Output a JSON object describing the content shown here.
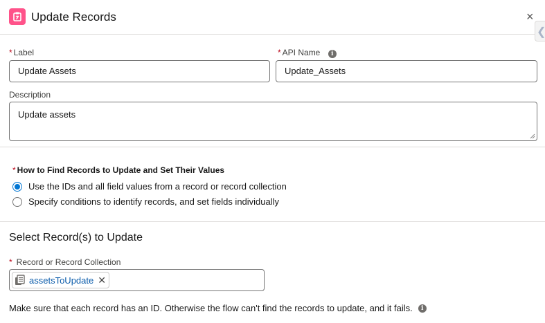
{
  "header": {
    "title": "Update Records",
    "accent_color": "#ff538a",
    "icon": "update-records-icon",
    "close_glyph": "×",
    "edge_tab_glyph": "❮"
  },
  "form": {
    "required_marker": "*",
    "label": {
      "label": "Label",
      "value": "Update Assets"
    },
    "api_name": {
      "label": "API Name",
      "value": "Update_Assets"
    },
    "description": {
      "label": "Description",
      "value": "Update assets"
    }
  },
  "find_records": {
    "heading": "How to Find Records to Update and Set Their Values",
    "options": [
      {
        "label": "Use the IDs and all field values from a record or record collection",
        "selected": true
      },
      {
        "label": "Specify conditions to identify records, and set fields individually",
        "selected": false
      }
    ]
  },
  "select_section": {
    "title": "Select Record(s) to Update",
    "field_label": "Record or Record Collection",
    "pill_value": "assetsToUpdate",
    "pill_remove_glyph": "✕",
    "help_text": "Make sure that each record has an ID. Otherwise the flow can't find the records to update, and it fails."
  },
  "info_glyph": "i",
  "colors": {
    "brand": "#0176d3",
    "required": "#ba0517",
    "link": "#0b5cab"
  }
}
